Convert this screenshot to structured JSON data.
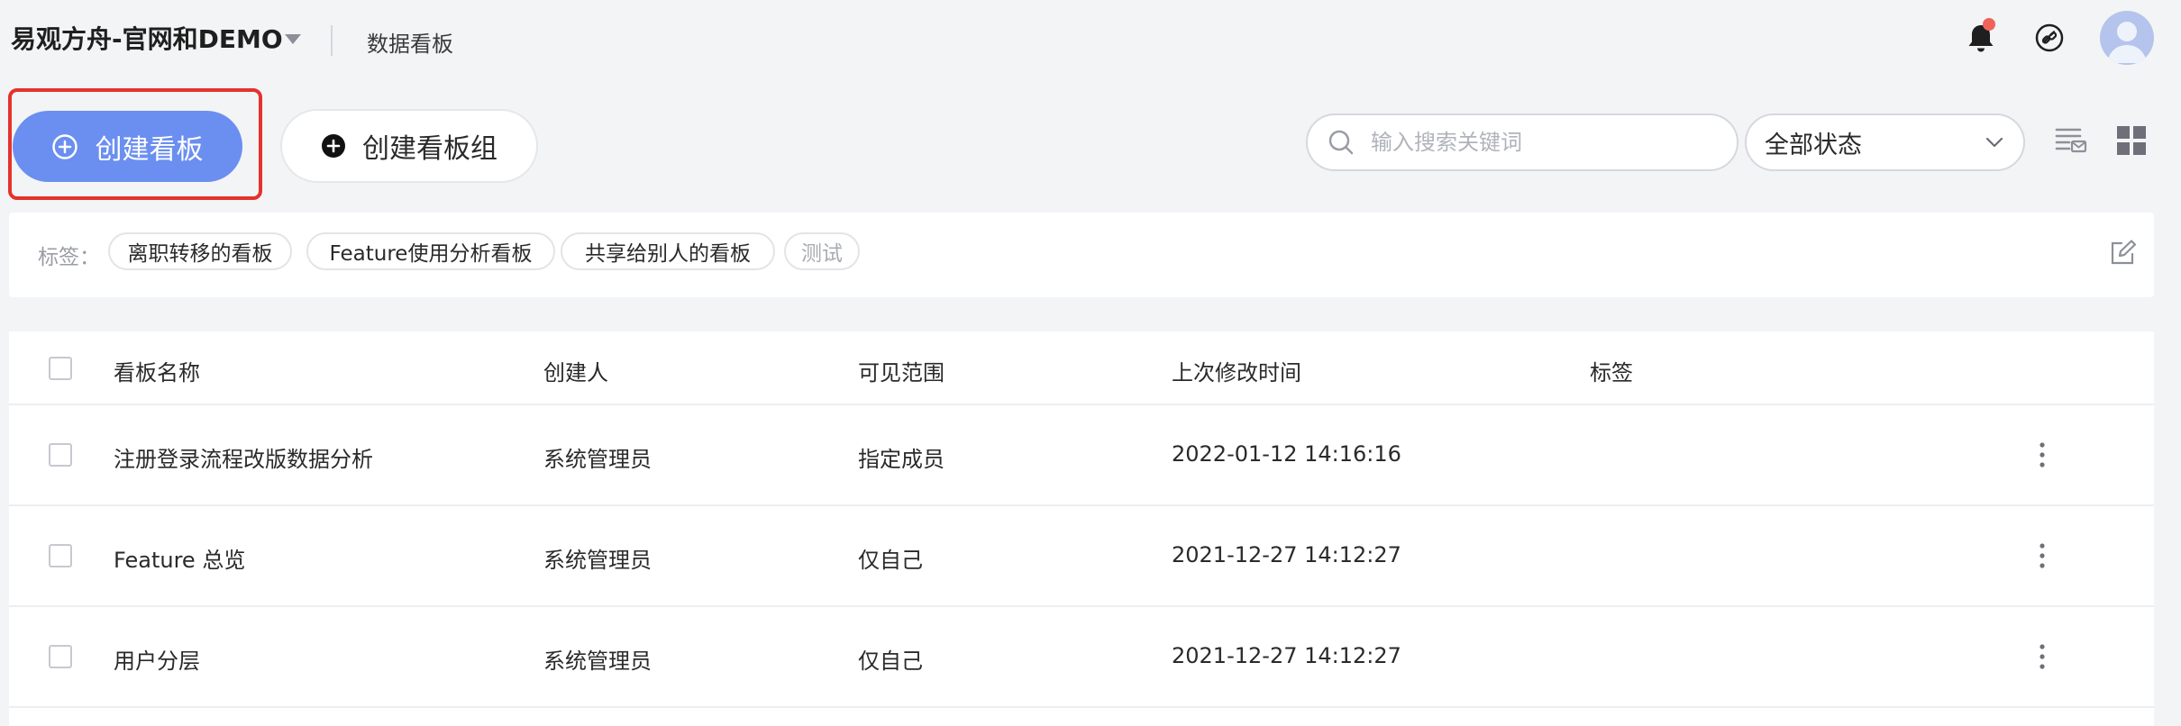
{
  "header": {
    "app_title": "易观方舟-官网和DEMO",
    "page_title": "数据看板"
  },
  "toolbar": {
    "create_board": "创建看板",
    "create_board_group": "创建看板组",
    "search_placeholder": "输入搜索关键词",
    "status_selected": "全部状态"
  },
  "tags": {
    "label": "标签：",
    "items": [
      "离职转移的看板",
      "Feature使用分析看板",
      "共享给别人的看板",
      "测试"
    ]
  },
  "table": {
    "columns": [
      "看板名称",
      "创建人",
      "可见范围",
      "上次修改时间",
      "标签"
    ],
    "rows": [
      {
        "name": "注册登录流程改版数据分析",
        "creator": "系统管理员",
        "scope": "指定成员",
        "modified": "2022-01-12 14:16:16",
        "tag": ""
      },
      {
        "name": "Feature 总览",
        "creator": "系统管理员",
        "scope": "仅自己",
        "modified": "2021-12-27 14:12:27",
        "tag": ""
      },
      {
        "name": "用户分层",
        "creator": "系统管理员",
        "scope": "仅自己",
        "modified": "2021-12-27 14:12:27",
        "tag": ""
      }
    ]
  },
  "colors": {
    "accent": "#6b8ff0",
    "highlight": "#e5322d",
    "notification": "#f0635a"
  }
}
